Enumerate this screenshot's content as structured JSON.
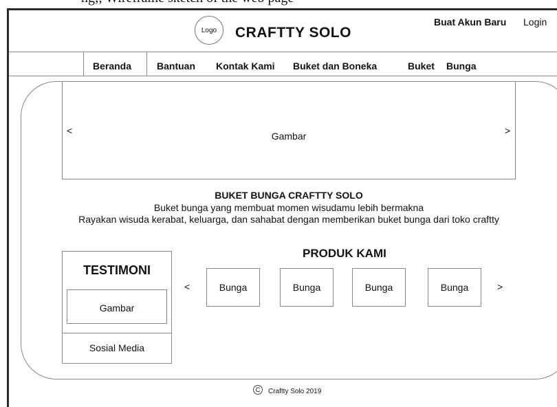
{
  "top_clip": {
    "text": "ng;, Wireframe sketch of the web page"
  },
  "header": {
    "logo_label": "Logo",
    "title": "CRAFTTY SOLO",
    "signup_label": "Buat Akun Baru",
    "login_label": "Login"
  },
  "nav": {
    "items": [
      "Beranda",
      "Bantuan",
      "Kontak Kami",
      "Buket dan Boneka",
      "Buket",
      "Bunga"
    ]
  },
  "banner": {
    "prev": "<",
    "label": "Gambar",
    "next": ">"
  },
  "hero": {
    "title": "BUKET BUNGA CRAFTTY SOLO",
    "line1": "Buket bunga yang membuat momen wisudamu lebih bermakna",
    "line2": "Rayakan wisuda kerabat, keluarga, dan sahabat dengan memberikan buket bunga dari toko craftty"
  },
  "testimoni": {
    "title": "TESTIMONI",
    "image_label": "Gambar",
    "social_label": "Sosial Media"
  },
  "products": {
    "title": "PRODUK KAMI",
    "prev": "<",
    "next": ">",
    "items": [
      "Bunga",
      "Bunga",
      "Bunga",
      "Bunga"
    ]
  },
  "footer": {
    "copyright_symbol": "C",
    "text": "Craftty Solo 2019"
  },
  "colors": {
    "line": "#888888",
    "frame": "#2b2b2b",
    "text": "#111111"
  }
}
